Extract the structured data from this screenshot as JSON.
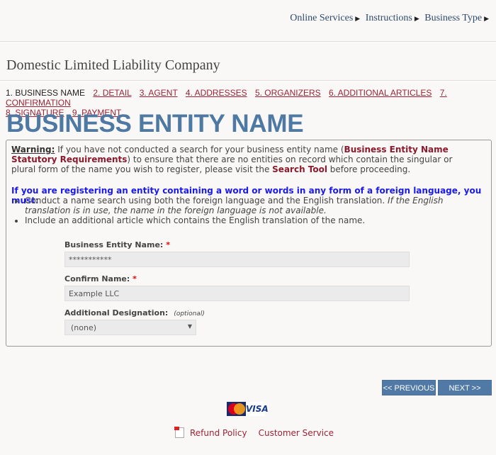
{
  "topnav": {
    "items": [
      "Online Services",
      "Instructions",
      "Business Type"
    ]
  },
  "page_title": "Domestic Limited Liability Company",
  "steps": {
    "current": "1. BUSINESS NAME",
    "links": [
      "2. DETAIL",
      "3. AGENT",
      "4. ADDRESSES",
      "5. ORGANIZERS",
      "6. ADDITIONAL ARTICLES",
      "7. CONFIRMATION",
      "8. SIGNATURE",
      "9. PAYMENT"
    ]
  },
  "heading": "BUSINESS ENTITY NAME",
  "warning": {
    "label": "Warning:",
    "text1": " If you have not conducted a search for your business entity name (",
    "link1": "Business Entity Name Statutory Requirements",
    "text2": ") to ensure that there are no entities on record which contain the singular or plural form of the name you wish to register, please visit the ",
    "link2": "Search Tool",
    "text3": " before proceeding."
  },
  "foreign": {
    "heading": "If you are registering an entity containing a word or words in any form of a foreign language, you must:",
    "bullet1": "Conduct a name search using both the foreign language and the English translation. ",
    "bullet1_italic": "If the English translation is in use, the name in the foreign language is not available.",
    "bullet2": "Include an additional article which contains the English translation of the name."
  },
  "form": {
    "entity_name": {
      "label": "Business Entity Name:",
      "value": "***********",
      "required": "*"
    },
    "confirm_name": {
      "label": "Confirm Name:",
      "value": "Example LLC",
      "required": "*"
    },
    "designation": {
      "label": "Additional Designation:",
      "optional": "(optional)",
      "value": "(none)"
    }
  },
  "buttons": {
    "previous": "<< PREVIOUS",
    "next": "NEXT >>"
  },
  "cards": {
    "mastercard": "MasterCard",
    "visa": "VISA"
  },
  "footer": {
    "refund": "Refund Policy",
    "service": "Customer Service"
  },
  "colors": {
    "accent": "#4e79a3",
    "link": "#9b2335",
    "foreign": "#1a1aee"
  }
}
